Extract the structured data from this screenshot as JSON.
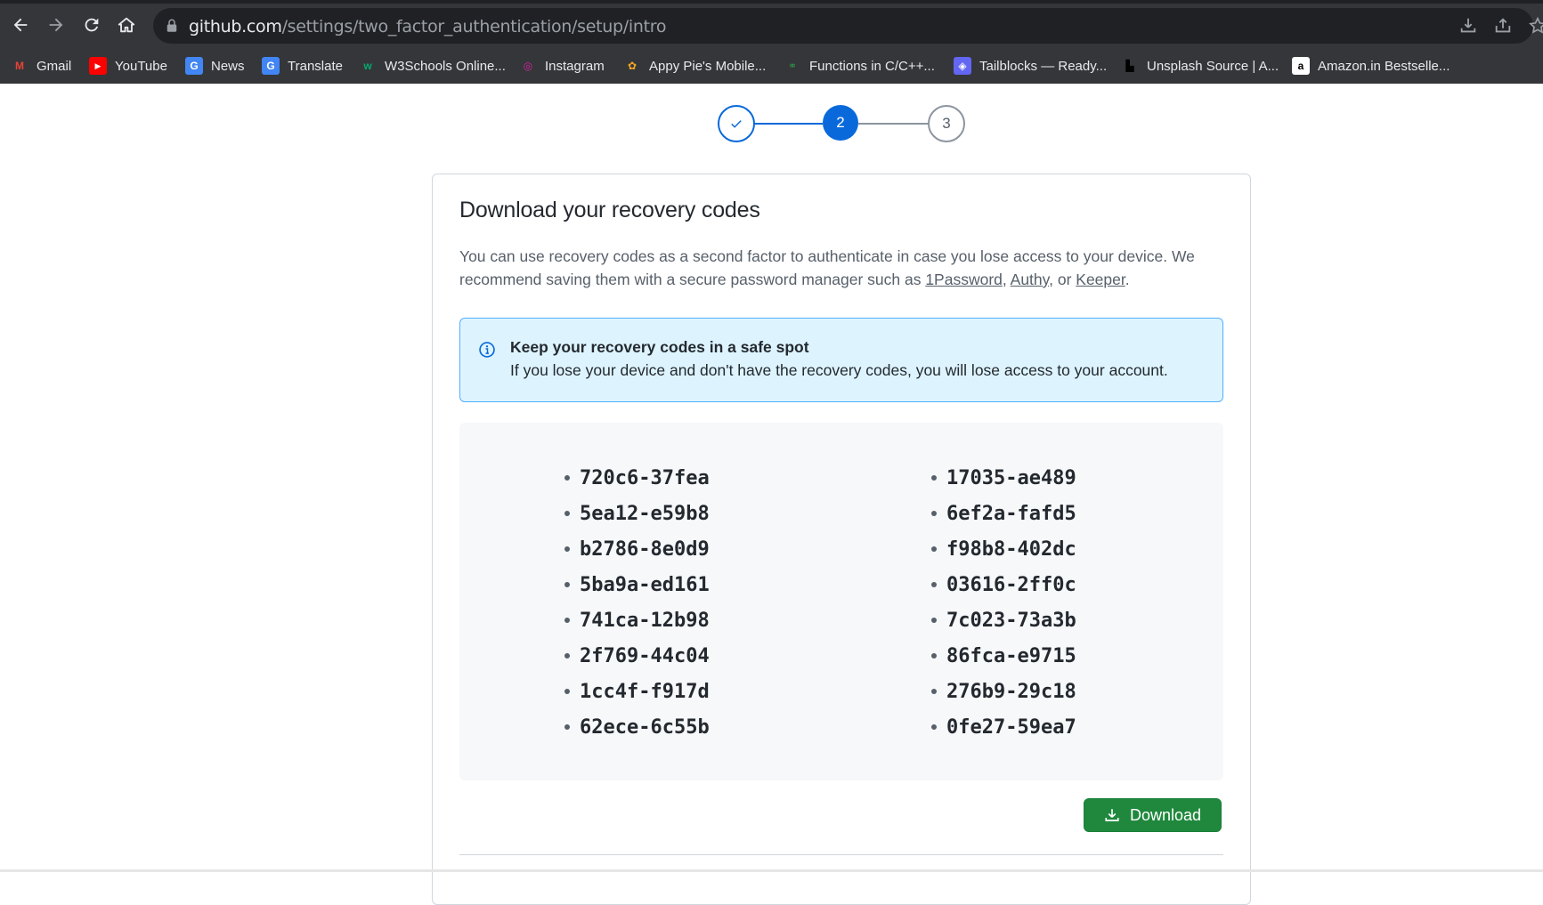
{
  "browser": {
    "url_domain": "github.com",
    "url_path": "/settings/two_factor_authentication/setup/intro",
    "bookmarks": [
      {
        "label": "Gmail",
        "icon": "gmail-icon",
        "color": "#ea4335"
      },
      {
        "label": "YouTube",
        "icon": "youtube-icon",
        "color": "#ff0000"
      },
      {
        "label": "News",
        "icon": "google-news-icon",
        "color": "#4285f4"
      },
      {
        "label": "Translate",
        "icon": "google-translate-icon",
        "color": "#4285f4"
      },
      {
        "label": "W3Schools Online...",
        "icon": "w3schools-icon",
        "color": "#04aa6d"
      },
      {
        "label": "Instagram",
        "icon": "instagram-icon",
        "color": "#d6249f"
      },
      {
        "label": "Appy Pie's Mobile...",
        "icon": "appypie-icon",
        "color": "#f5a623"
      },
      {
        "label": "Functions in C/C++...",
        "icon": "geeksforgeeks-icon",
        "color": "#2f8d46"
      },
      {
        "label": "Tailblocks — Ready...",
        "icon": "tailblocks-icon",
        "color": "#6366f1"
      },
      {
        "label": "Unsplash Source | A...",
        "icon": "unsplash-icon",
        "color": "#000000"
      },
      {
        "label": "Amazon.in Bestselle...",
        "icon": "amazon-icon",
        "color": "#ffffff"
      }
    ]
  },
  "stepper": {
    "steps": [
      {
        "label": "",
        "state": "done"
      },
      {
        "label": "2",
        "state": "active"
      },
      {
        "label": "3",
        "state": "pending"
      }
    ]
  },
  "card": {
    "title": "Download your recovery codes",
    "desc_before": "You can use recovery codes as a second factor to authenticate in case you lose access to your device. We recommend saving them with a secure password manager such as ",
    "link_1password": "1Password",
    "sep1": ", ",
    "link_authy": "Authy",
    "sep2": ", or ",
    "link_keeper": "Keeper",
    "desc_after": "."
  },
  "flash": {
    "title": "Keep your recovery codes in a safe spot",
    "text": "If you lose your device and don't have the recovery codes, you will lose access to your account."
  },
  "codes": {
    "col1": [
      "720c6-37fea",
      "5ea12-e59b8",
      "b2786-8e0d9",
      "5ba9a-ed161",
      "741ca-12b98",
      "2f769-44c04",
      "1cc4f-f917d",
      "62ece-6c55b"
    ],
    "col2": [
      "17035-ae489",
      "6ef2a-fafd5",
      "f98b8-402dc",
      "03616-2ff0c",
      "7c023-73a3b",
      "86fca-e9715",
      "276b9-29c18",
      "0fe27-59ea7"
    ]
  },
  "actions": {
    "download_label": "Download"
  },
  "colors": {
    "accent_blue": "#0969da",
    "success_green": "#1f883d",
    "flash_bg": "#ddf4ff"
  }
}
